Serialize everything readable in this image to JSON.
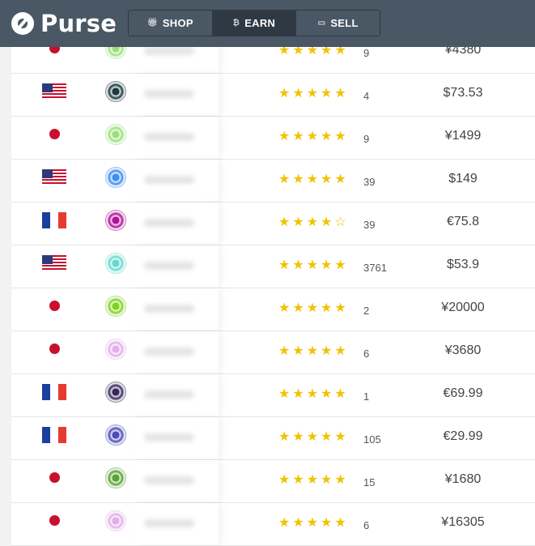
{
  "brand": {
    "name": "Purse"
  },
  "nav": {
    "tabs": [
      {
        "label": "SHOP",
        "icon": "gift-icon",
        "active": false
      },
      {
        "label": "EARN",
        "icon": "bitcoin-icon",
        "active": true
      },
      {
        "label": "SELL",
        "icon": "card-icon",
        "active": false
      }
    ]
  },
  "listings": [
    {
      "country": "jp",
      "rating": 5,
      "count": "9",
      "price": "¥4380",
      "avatar_color": "#9be07a"
    },
    {
      "country": "us",
      "rating": 5,
      "count": "4",
      "price": "$73.53",
      "avatar_color": "#1e3b3f"
    },
    {
      "country": "jp",
      "rating": 5,
      "count": "9",
      "price": "¥1499",
      "avatar_color": "#9be07a"
    },
    {
      "country": "us",
      "rating": 5,
      "count": "39",
      "price": "$149",
      "avatar_color": "#3d8ff0"
    },
    {
      "country": "fr",
      "rating": 4.5,
      "count": "39",
      "price": "€75.8",
      "avatar_color": "#b0149a"
    },
    {
      "country": "us",
      "rating": 5,
      "count": "3761",
      "price": "$53.9",
      "avatar_color": "#66d9cf"
    },
    {
      "country": "jp",
      "rating": 5,
      "count": "2",
      "price": "¥20000",
      "avatar_color": "#7ed321"
    },
    {
      "country": "jp",
      "rating": 5,
      "count": "6",
      "price": "¥3680",
      "avatar_color": "#e3aee9"
    },
    {
      "country": "fr",
      "rating": 5,
      "count": "1",
      "price": "€69.99",
      "avatar_color": "#3a2a5c"
    },
    {
      "country": "fr",
      "rating": 5,
      "count": "105",
      "price": "€29.99",
      "avatar_color": "#4b4db8"
    },
    {
      "country": "jp",
      "rating": 5,
      "count": "15",
      "price": "¥1680",
      "avatar_color": "#5aa33a"
    },
    {
      "country": "jp",
      "rating": 5,
      "count": "6",
      "price": "¥16305",
      "avatar_color": "#e3aee9"
    }
  ]
}
